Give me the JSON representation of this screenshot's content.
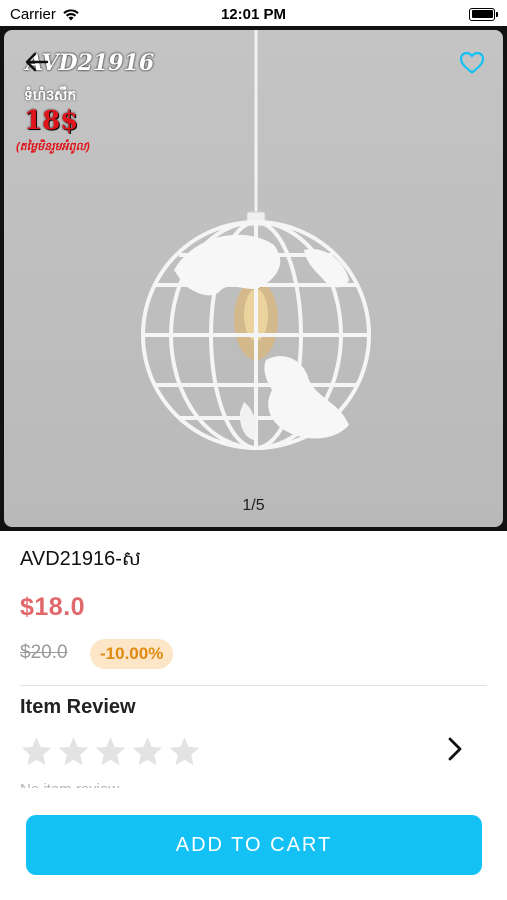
{
  "status_bar": {
    "carrier": "Carrier",
    "time": "12:01 PM",
    "wifi_icon": "wifi-icon",
    "battery_icon": "battery-icon"
  },
  "gallery": {
    "overlay_code": "AVD21916",
    "overlay_khmer": "ទំហំ3សឹក",
    "overlay_price": "18$",
    "overlay_note": "(តម្លៃមិនរួមអំពូល)",
    "pager": "1/5",
    "back_icon": "back-arrow-icon",
    "favorite_icon": "heart-outline-icon",
    "accent_color": "#14c1f5"
  },
  "product": {
    "title": "AVD21916-ស",
    "price": "$18.0",
    "original_price": "$20.0",
    "discount": "-10.00%",
    "price_color": "#e0676a",
    "discount_color": "#e08a12",
    "discount_bg": "#fde6c8"
  },
  "review": {
    "heading": "Item Review",
    "rating": 0,
    "max_rating": 5,
    "empty_text": "No item review",
    "arrow_icon": "chevron-right-icon"
  },
  "actions": {
    "add_to_cart_label": "ADD TO CART",
    "button_color": "#14c1f5"
  }
}
